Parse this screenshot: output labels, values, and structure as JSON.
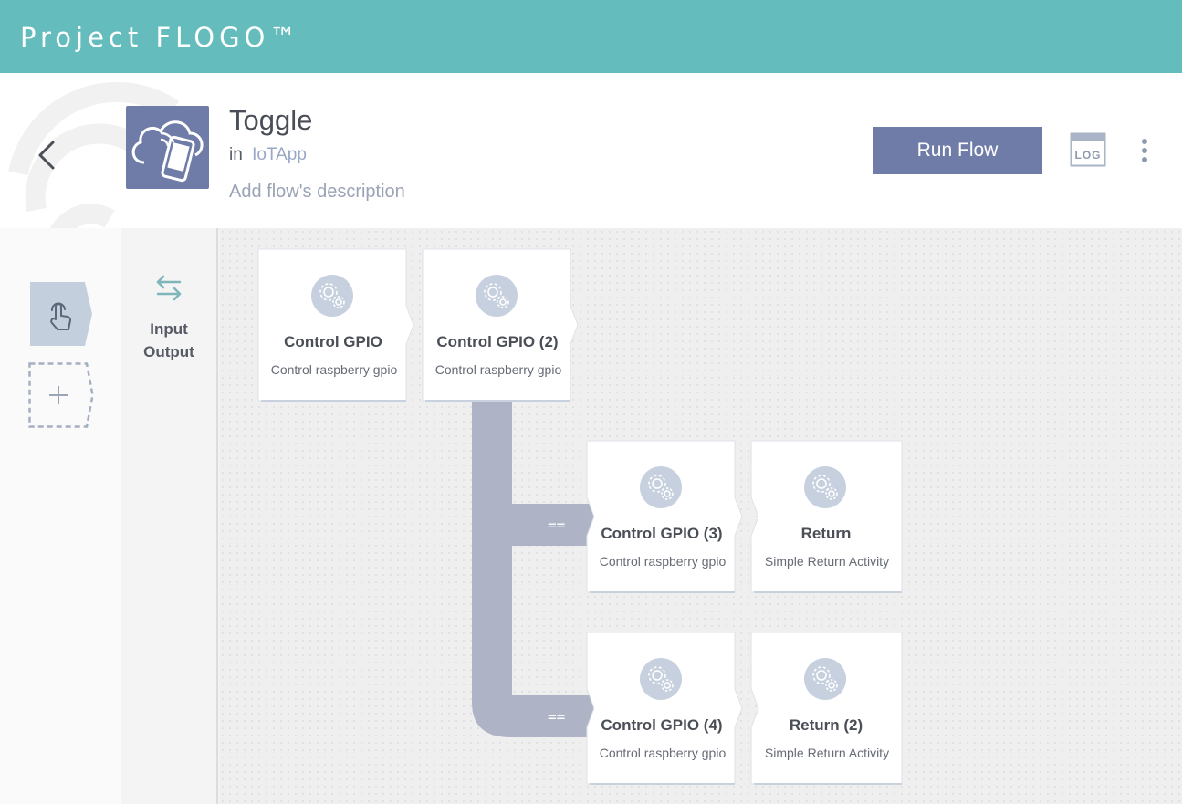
{
  "app": {
    "brand": "Project FLOGO™"
  },
  "flow": {
    "name": "Toggle",
    "in_label": "in",
    "app_name": "IoTApp",
    "description_placeholder": "Add flow's description",
    "icon": "cloud-phone-icon"
  },
  "toolbar": {
    "run_label": "Run Flow",
    "log_label": "LOG",
    "more_icon": "more-vertical-icon"
  },
  "sidebar": {
    "trigger_icon": "touch-icon",
    "add_icon": "plus-icon"
  },
  "io_panel": {
    "line1": "Input",
    "line2": "Output",
    "icon": "swap-arrows-icon"
  },
  "tasks": [
    {
      "title": "Control GPIO",
      "description": "Control raspberry gpio"
    },
    {
      "title": "Control GPIO (2)",
      "description": "Control raspberry gpio"
    },
    {
      "title": "Control GPIO (3)",
      "description": "Control raspberry gpio"
    },
    {
      "title": "Return",
      "description": "Simple Return Activity"
    },
    {
      "title": "Control GPIO (4)",
      "description": "Control raspberry gpio"
    },
    {
      "title": "Return (2)",
      "description": "Simple Return Activity"
    }
  ],
  "branches": [
    {
      "label": "=="
    },
    {
      "label": "=="
    }
  ],
  "colors": {
    "header": "#64bcbd",
    "accent": "#6f7ca8",
    "branch": "#aeb4c6",
    "task_icon_bg": "#c6d0de"
  }
}
